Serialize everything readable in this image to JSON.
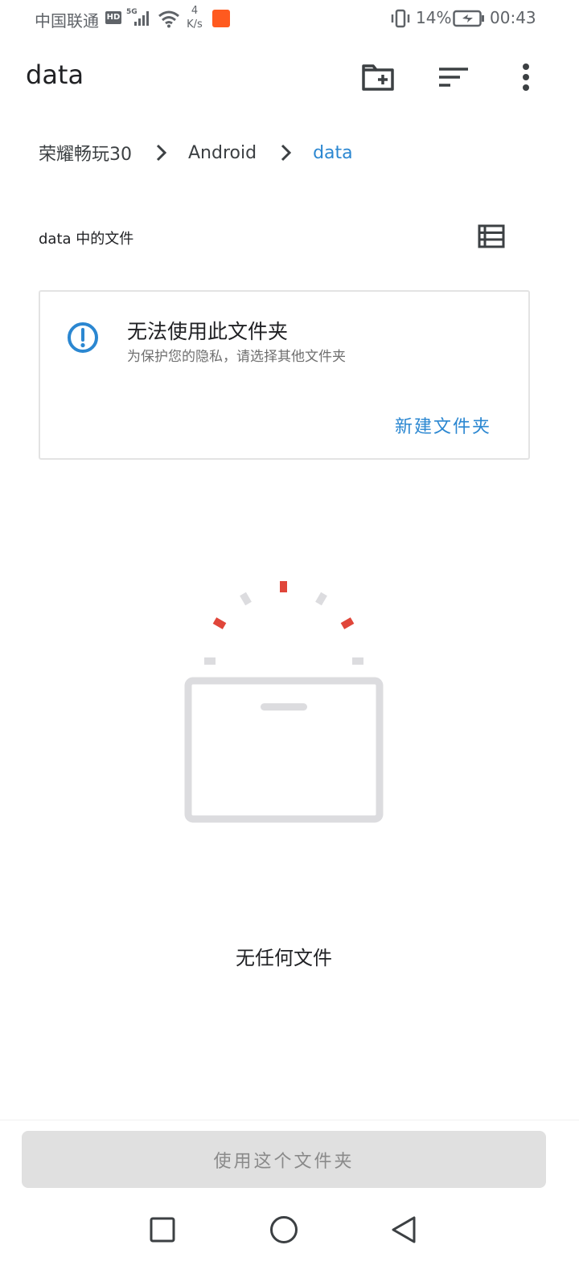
{
  "status_bar": {
    "carrier": "中国联通",
    "hd_badge": "HD",
    "network_type": "5G",
    "speed_value": "4",
    "speed_unit": "K/s",
    "battery_percent": "14%",
    "time": "00:43"
  },
  "app_bar": {
    "title": "data"
  },
  "breadcrumb": {
    "items": [
      "荣耀畅玩30",
      "Android",
      "data"
    ]
  },
  "files_section": {
    "heading": "data 中的文件"
  },
  "warning_card": {
    "title": "无法使用此文件夹",
    "subtitle": "为保护您的隐私，请选择其他文件夹",
    "action_label": "新建文件夹"
  },
  "empty_state": {
    "message": "无任何文件"
  },
  "bottom": {
    "use_folder_label": "使用这个文件夹"
  },
  "colors": {
    "accent": "#2b87d1",
    "text_primary": "#202124",
    "illustration_red": "#e0463a",
    "illustration_gray": "#dcdcdf",
    "button_disabled_bg": "#e0e0e0"
  },
  "icons": {
    "new_folder": "create-new-folder-icon",
    "sort": "sort-icon",
    "more": "more-vert-icon",
    "list_view": "list-view-icon",
    "warning": "info-alert-icon",
    "nav_recents": "square-nav-icon",
    "nav_home": "circle-nav-icon",
    "nav_back": "triangle-back-icon"
  }
}
